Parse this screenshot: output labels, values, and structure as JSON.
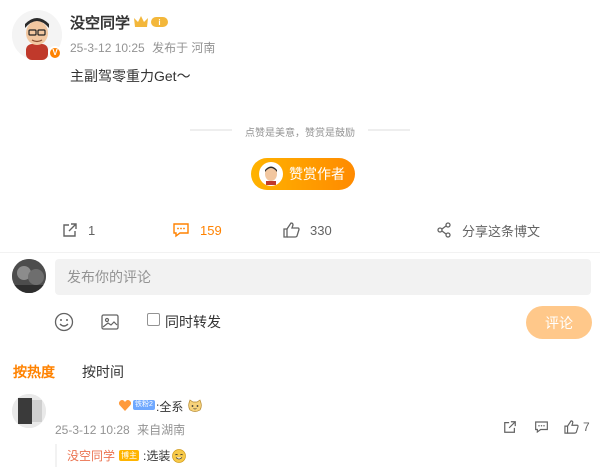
{
  "post": {
    "author_name": "没空同学",
    "time": "25-3-12 10:25",
    "location": "发布于 河南",
    "text": "主副驾零重力Get～"
  },
  "tip": {
    "text": "点赞是美意，赞赏是鼓励",
    "reward_button": "赞赏作者"
  },
  "actions": {
    "reposts": "1",
    "comments": "159",
    "likes": "330",
    "share": "分享这条博文"
  },
  "composer": {
    "placeholder": "发布你的评论",
    "repost_label": "同时转发",
    "submit": "评论"
  },
  "sort": {
    "hot": "按热度",
    "time": "按时间"
  },
  "comment": {
    "level": "铁粉2",
    "text": ":全系",
    "time": "25-3-12 10:28",
    "location": "来自湖南",
    "likes": "7",
    "reply": {
      "author": "没空同学",
      "badge": "博主",
      "text": ":选装"
    }
  },
  "colors": {
    "accent": "#ff8200",
    "reply_name": "#eb7350",
    "muted": "#939393"
  }
}
